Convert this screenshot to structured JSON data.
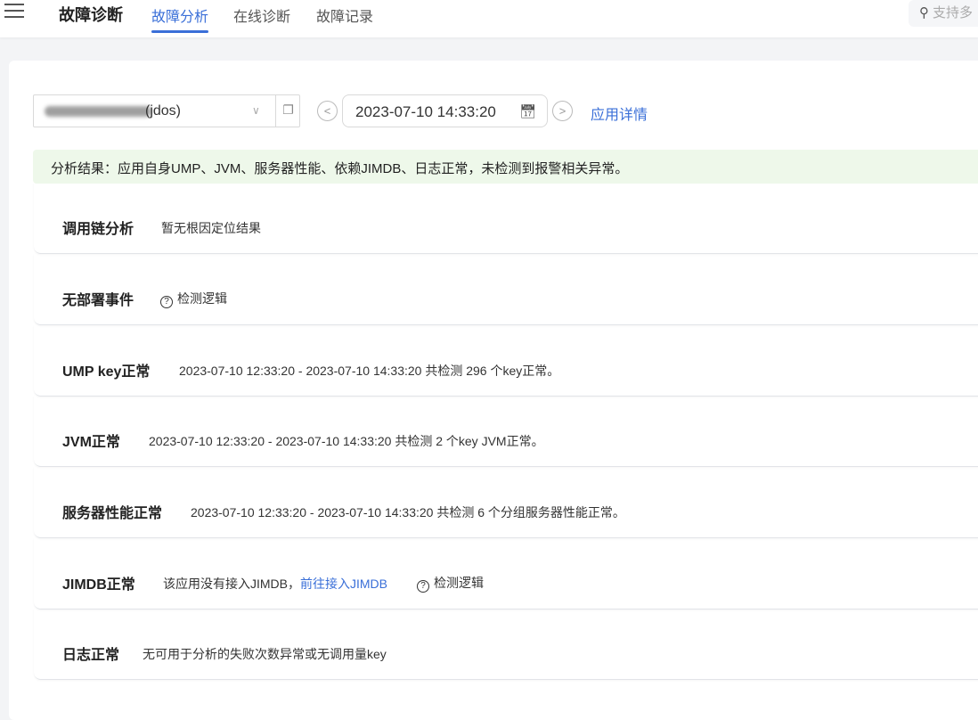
{
  "header": {
    "brand": "故障诊断",
    "tabs": [
      "故障分析",
      "在线诊断",
      "故障记录"
    ],
    "active_tab": 0,
    "search_placeholder": "支持多"
  },
  "toolbar": {
    "app_select_suffix": "(jdos)",
    "datetime": "2023-07-10 14:33:20",
    "app_details": "应用详情"
  },
  "result": "分析结果：应用自身UMP、JVM、服务器性能、依赖JIMDB、日志正常，未检测到报警相关异常。",
  "rows": [
    {
      "title": "调用链分析",
      "desc": "暂无根因定位结果"
    },
    {
      "title": "无部署事件",
      "logic": "检测逻辑"
    },
    {
      "title": "UMP key正常",
      "desc": "2023-07-10 12:33:20 - 2023-07-10 14:33:20 共检测 296 个key正常。"
    },
    {
      "title": "JVM正常",
      "desc": "2023-07-10 12:33:20 - 2023-07-10 14:33:20 共检测 2 个key JVM正常。"
    },
    {
      "title": "服务器性能正常",
      "desc": "2023-07-10 12:33:20 - 2023-07-10 14:33:20 共检测 6 个分组服务器性能正常。"
    },
    {
      "title": "JIMDB正常",
      "desc": "该应用没有接入JIMDB，",
      "link": "前往接入JIMDB",
      "logic": "检测逻辑"
    },
    {
      "title": "日志正常",
      "desc": "无可用于分析的失败次数异常或无调用量key"
    }
  ]
}
